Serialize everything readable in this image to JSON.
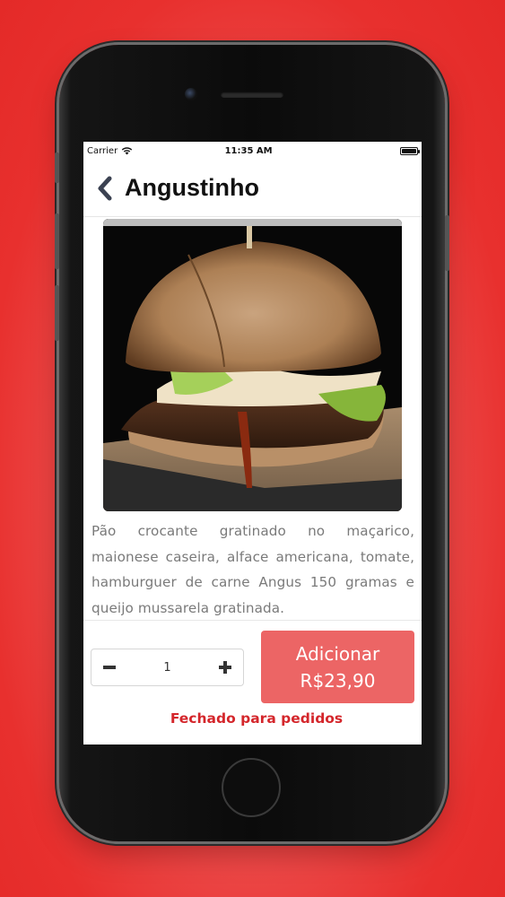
{
  "status_bar": {
    "carrier": "Carrier",
    "time": "11:35 AM"
  },
  "header": {
    "title": "Angustinho"
  },
  "product": {
    "description": "Pão crocante gratinado no maçarico, maionese caseira, alface americana, tomate, hamburguer de carne Angus 150 gramas e queijo mussarela gratinada."
  },
  "order": {
    "quantity": "1",
    "add_label": "Adicionar",
    "price": "R$23,90",
    "status": "Fechado para pedidos"
  },
  "colors": {
    "background": "#e8302e",
    "button": "#ec6565",
    "status_text": "#d4262b"
  }
}
